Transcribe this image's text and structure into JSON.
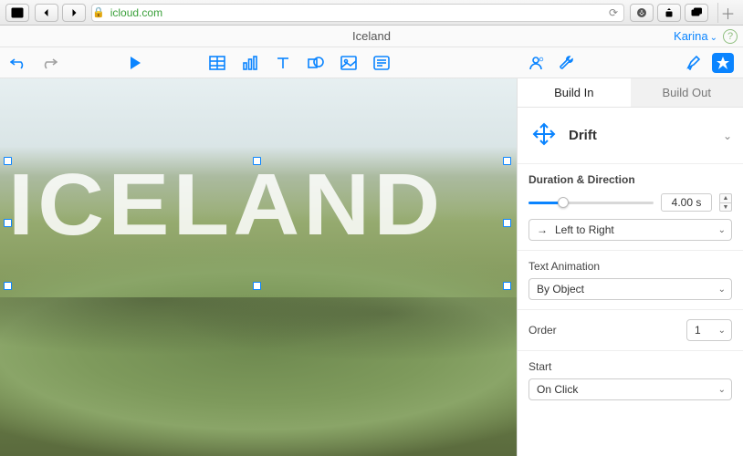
{
  "browser": {
    "url": "icloud.com"
  },
  "document": {
    "title": "Iceland",
    "user": "Karina"
  },
  "canvas": {
    "main_text": "ICELAND"
  },
  "inspector": {
    "tabs": {
      "build_in": "Build In",
      "build_out": "Build Out"
    },
    "effect": {
      "name": "Drift"
    },
    "duration": {
      "heading": "Duration & Direction",
      "value": "4.00 s",
      "direction": "Left to Right",
      "direction_arrow": "→"
    },
    "text_anim": {
      "heading": "Text Animation",
      "value": "By Object"
    },
    "order": {
      "label": "Order",
      "value": "1"
    },
    "start": {
      "label": "Start",
      "value": "On Click"
    }
  }
}
